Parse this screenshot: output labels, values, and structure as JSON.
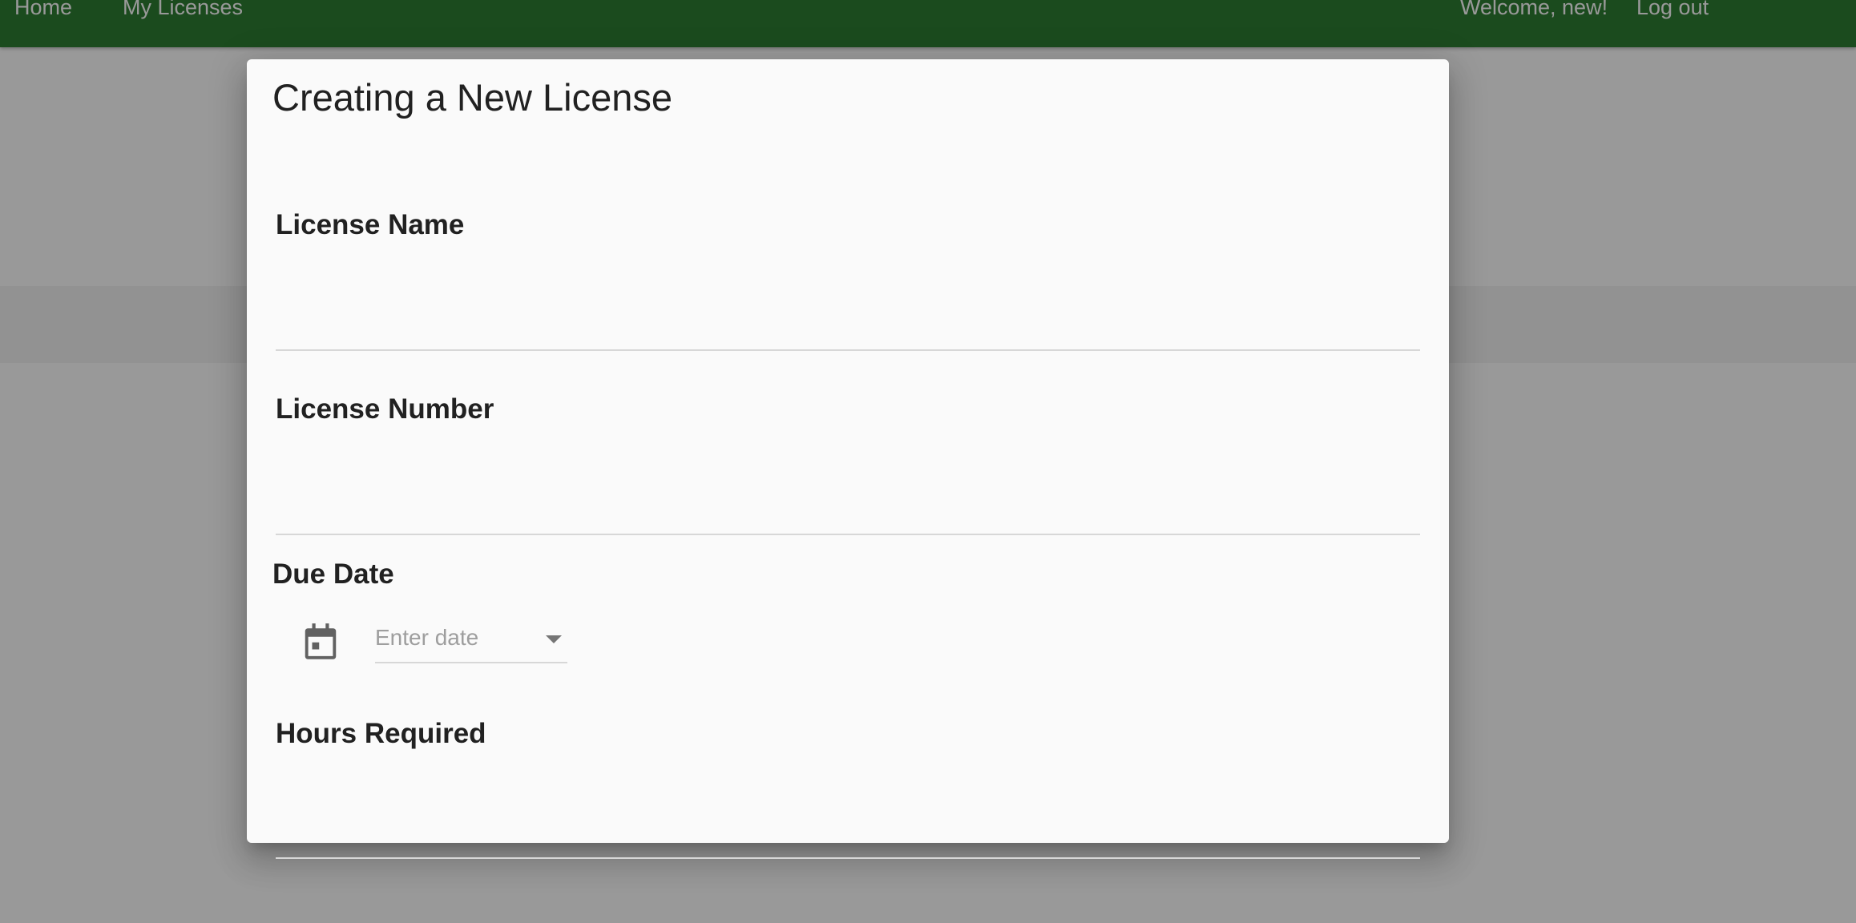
{
  "nav": {
    "home": "Home",
    "my_licenses": "My Licenses",
    "welcome": "Welcome, new!",
    "logout": "Log out"
  },
  "dialog": {
    "title": "Creating a New License",
    "fields": {
      "license_name": {
        "label": "License Name",
        "value": ""
      },
      "license_number": {
        "label": "License Number",
        "value": ""
      },
      "due_date": {
        "label": "Due Date",
        "placeholder": "Enter date",
        "icon": "calendar-icon",
        "dropdown_icon": "arrow-drop-down-icon"
      },
      "hours_required": {
        "label": "Hours Required",
        "value": ""
      }
    }
  },
  "colors": {
    "navbar": "#2e7d32",
    "dialog_bg": "#fafafa",
    "text": "#212121",
    "underline": "#d7d7d7",
    "placeholder": "#9e9e9e"
  }
}
